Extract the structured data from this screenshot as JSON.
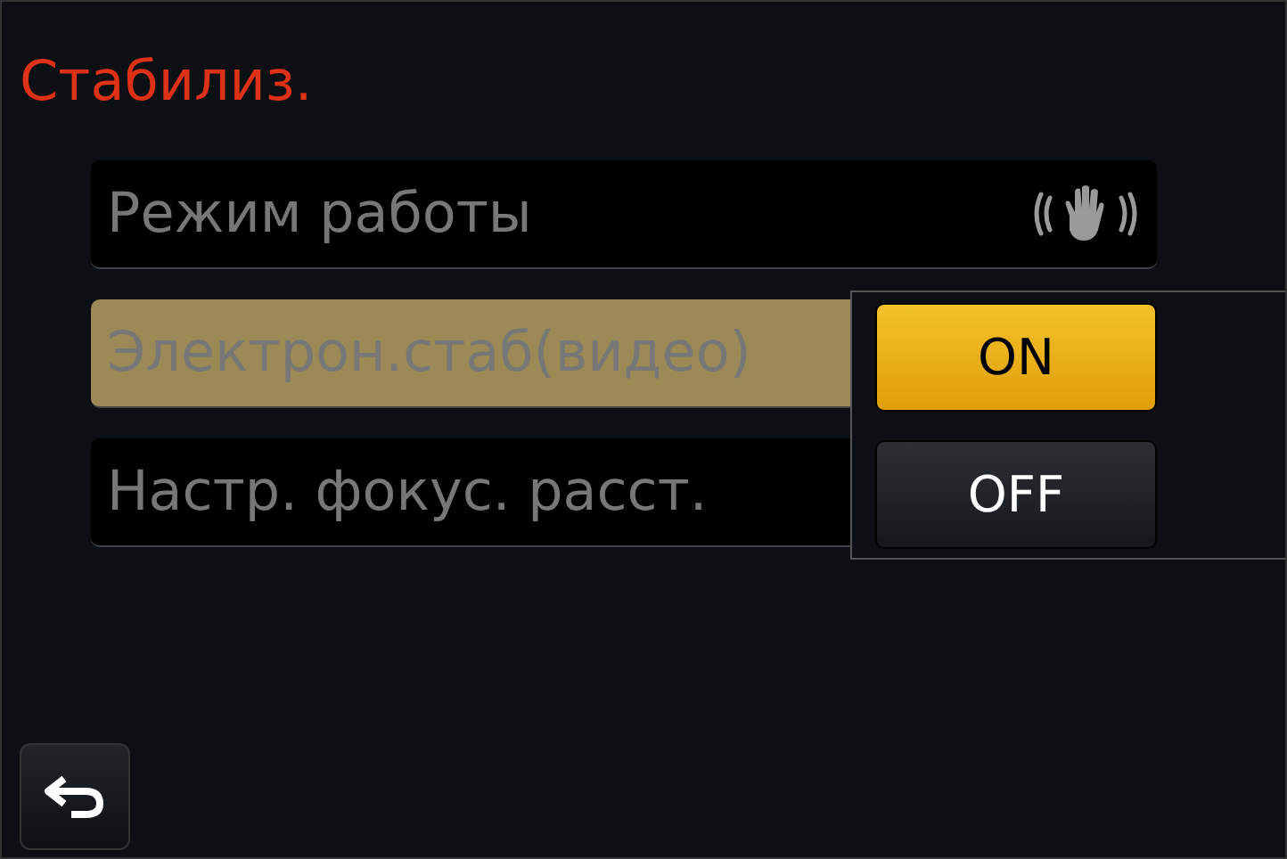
{
  "title": "Стабилиз.",
  "menu": [
    {
      "label": "Режим работы",
      "selected": false,
      "kind": "icon"
    },
    {
      "label": "Электрон.стаб(видео)",
      "selected": true,
      "kind": "plain"
    },
    {
      "label": "Настр. фокус. расст.",
      "selected": false,
      "kind": "plain"
    }
  ],
  "options": [
    {
      "label": "ON",
      "selected": true
    },
    {
      "label": "OFF",
      "selected": false
    }
  ]
}
